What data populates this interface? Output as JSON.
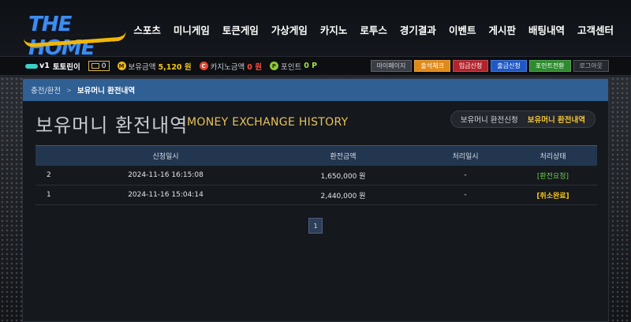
{
  "brand": {
    "name": "THE HOME"
  },
  "nav": [
    "스포츠",
    "미니게임",
    "토큰게임",
    "가상게임",
    "카지노",
    "로투스",
    "경기결과",
    "이벤트",
    "게시판",
    "배팅내역",
    "고객센터"
  ],
  "user": {
    "level": "v1",
    "name": "토토린이",
    "messages": "0",
    "money_label": "보유금액",
    "money_value": "5,120 원",
    "casino_label": "카지노금액",
    "casino_value": "0 원",
    "point_label": "포인트",
    "point_value": "0 P"
  },
  "account_buttons": [
    "마이페이지",
    "출석체크",
    "입금신청",
    "출금신청",
    "포인트전환",
    "로그아웃"
  ],
  "breadcrumb": {
    "parent": "충전/환전",
    "current": "보유머니 환전내역"
  },
  "page": {
    "title": "보유머니 환전내역",
    "subtitle": "MONEY EXCHANGE HISTORY"
  },
  "tabs": [
    "보유머니 환전신청",
    "보유머니 환전내역"
  ],
  "table": {
    "headers": [
      "",
      "신청일시",
      "환전금액",
      "처리일시",
      "처리상태"
    ],
    "rows": [
      {
        "no": "2",
        "date": "2024-11-16 16:15:08",
        "amount": "1,650,000 원",
        "processed": "-",
        "status": "[환전요청]"
      },
      {
        "no": "1",
        "date": "2024-11-16 15:04:14",
        "amount": "2,440,000 원",
        "processed": "-",
        "status": "[취소완료]"
      }
    ]
  },
  "pagination": {
    "current": "1"
  },
  "colors": {
    "accent": "#f3c438",
    "breadcrumb_bg": "#2f5f93",
    "status_request": "#6bcf4a",
    "status_cancel": "#f5c518"
  }
}
